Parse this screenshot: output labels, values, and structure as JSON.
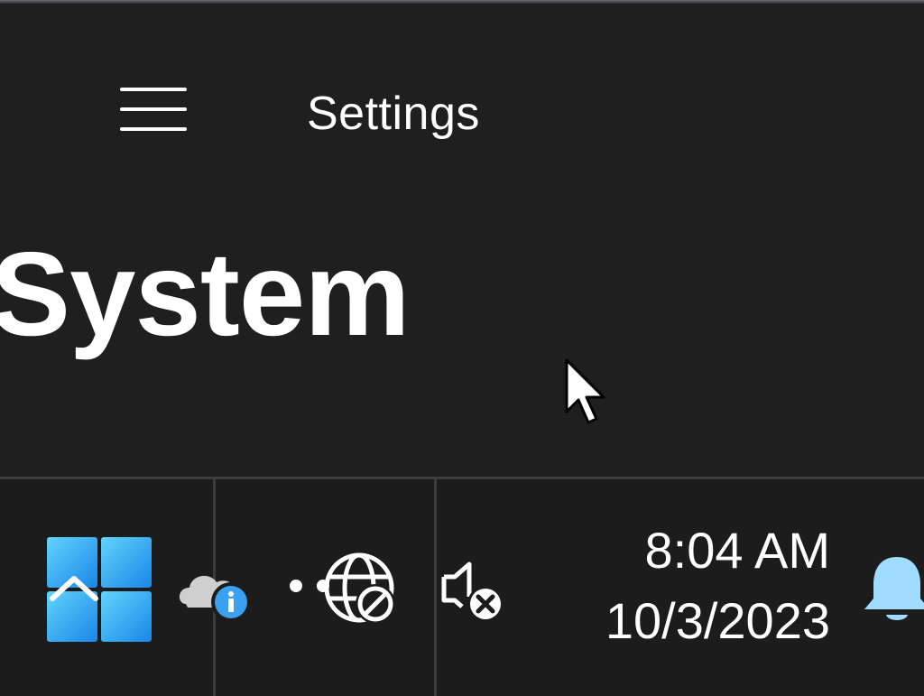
{
  "window": {
    "app_title": "Settings",
    "page_title": "System"
  },
  "taskbar": {
    "time": "8:04 AM",
    "date": "10/3/2023"
  },
  "icons": {
    "menu": "hamburger-menu-icon",
    "cursor": "mouse-pointer-icon",
    "start": "windows-start-icon",
    "onedrive": "onedrive-cloud-info-icon",
    "network": "globe-no-internet-icon",
    "volume": "speaker-muted-icon",
    "notifications": "notification-bell-icon"
  },
  "colors": {
    "background": "#1f1f1f",
    "taskbar": "#1c1c1c",
    "accent_blue": "#3aa0f0",
    "bell": "#9fdcff"
  }
}
